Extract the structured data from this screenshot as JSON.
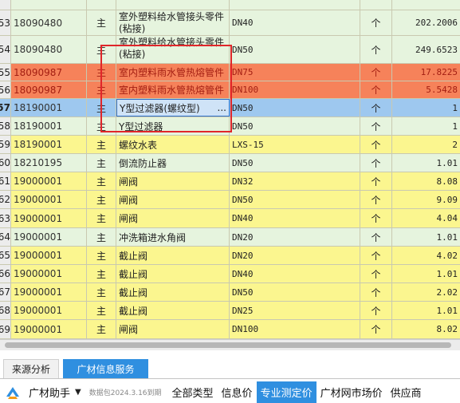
{
  "grid": {
    "rows": [
      {
        "index": "",
        "code": "",
        "main": "",
        "name": "(粘接)",
        "spec": "",
        "unit": "",
        "qty": "",
        "color": "green"
      },
      {
        "index": "53",
        "code": "18090480",
        "main": "主",
        "name": "室外塑料给水管接头零件(粘接)",
        "spec": "DN40",
        "unit": "个",
        "qty": "202.2006",
        "color": "green"
      },
      {
        "index": "54",
        "code": "18090480",
        "main": "主",
        "name": "室外塑料给水管接头零件(粘接)",
        "spec": "DN50",
        "unit": "个",
        "qty": "249.6523",
        "color": "green"
      },
      {
        "index": "55",
        "code": "18090987",
        "main": "主",
        "name": "室内塑料雨水管热熔管件",
        "spec": "DN75",
        "unit": "个",
        "qty": "17.8225",
        "color": "orange"
      },
      {
        "index": "56",
        "code": "18090987",
        "main": "主",
        "name": "室内塑料雨水管热熔管件",
        "spec": "DN100",
        "unit": "个",
        "qty": "5.5428",
        "color": "orange"
      },
      {
        "index": "57",
        "code": "18190001",
        "main": "主",
        "name": "Y型过滤器(螺纹型)",
        "spec": "DN50",
        "unit": "个",
        "qty": "1",
        "color": "blue",
        "ellipsis": "..."
      },
      {
        "index": "58",
        "code": "18190001",
        "main": "主",
        "name": "Y型过滤器",
        "spec": "DN50",
        "unit": "个",
        "qty": "1",
        "color": "green"
      },
      {
        "index": "59",
        "code": "18190001",
        "main": "主",
        "name": "螺纹水表",
        "spec": "LXS-15",
        "unit": "个",
        "qty": "2",
        "color": "yellow"
      },
      {
        "index": "60",
        "code": "18210195",
        "main": "主",
        "name": "倒流防止器",
        "spec": "DN50",
        "unit": "个",
        "qty": "1.01",
        "color": "green"
      },
      {
        "index": "61",
        "code": "19000001",
        "main": "主",
        "name": "闸阀",
        "spec": "DN32",
        "unit": "个",
        "qty": "8.08",
        "color": "yellow"
      },
      {
        "index": "62",
        "code": "19000001",
        "main": "主",
        "name": "闸阀",
        "spec": "DN50",
        "unit": "个",
        "qty": "9.09",
        "color": "yellow"
      },
      {
        "index": "63",
        "code": "19000001",
        "main": "主",
        "name": "闸阀",
        "spec": "DN40",
        "unit": "个",
        "qty": "4.04",
        "color": "yellow"
      },
      {
        "index": "64",
        "code": "19000001",
        "main": "主",
        "name": "冲洗箱进水角阀",
        "spec": "DN20",
        "unit": "个",
        "qty": "1.01",
        "color": "green"
      },
      {
        "index": "65",
        "code": "19000001",
        "main": "主",
        "name": "截止阀",
        "spec": "DN20",
        "unit": "个",
        "qty": "4.02",
        "color": "yellow"
      },
      {
        "index": "66",
        "code": "19000001",
        "main": "主",
        "name": "截止阀",
        "spec": "DN40",
        "unit": "个",
        "qty": "1.01",
        "color": "yellow"
      },
      {
        "index": "67",
        "code": "19000001",
        "main": "主",
        "name": "截止阀",
        "spec": "DN50",
        "unit": "个",
        "qty": "2.02",
        "color": "yellow"
      },
      {
        "index": "68",
        "code": "19000001",
        "main": "主",
        "name": "截止阀",
        "spec": "DN25",
        "unit": "个",
        "qty": "1.01",
        "color": "yellow"
      },
      {
        "index": "69",
        "code": "19000001",
        "main": "主",
        "name": "闸阀",
        "spec": "DN100",
        "unit": "个",
        "qty": "8.02",
        "color": "yellow"
      }
    ]
  },
  "tabs": [
    {
      "label": "来源分析",
      "active": false
    },
    {
      "label": "广材信息服务",
      "active": true
    }
  ],
  "toolbar": {
    "logo_icon": "guangcai-logo-icon",
    "title": "广材助手",
    "caret": "▼",
    "version": "数据包2024.3.16到期",
    "buttons": [
      {
        "label": "全部类型",
        "active": false
      },
      {
        "label": "信息价",
        "active": false
      },
      {
        "label": "专业测定价",
        "active": true
      },
      {
        "label": "广材网市场价",
        "active": false
      },
      {
        "label": "供应商",
        "active": false
      }
    ]
  },
  "colors": {
    "green": "#e6f4de",
    "yellow": "#fbf68f",
    "orange": "#f6825a",
    "blue": "#9ec8ef",
    "accent": "#2f8fe0",
    "highlight_box": "#e0262a"
  }
}
